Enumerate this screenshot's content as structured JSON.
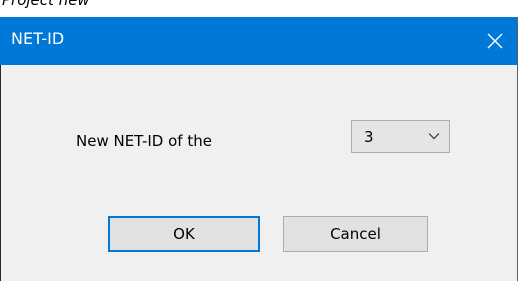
{
  "background_header_text": "Project new",
  "dialog": {
    "title": "NET-ID",
    "prompt_label": "New NET-ID of the",
    "netid_select": {
      "selected_value": "3"
    },
    "ok_label": "OK",
    "cancel_label": "Cancel"
  },
  "colors": {
    "titlebar": "#0078d7",
    "dialog_background": "#f0f0f0",
    "button_background": "#e1e1e1",
    "default_button_border": "#0078d7"
  },
  "icons": {
    "close": "close-icon",
    "dropdown": "chevron-down-icon"
  }
}
